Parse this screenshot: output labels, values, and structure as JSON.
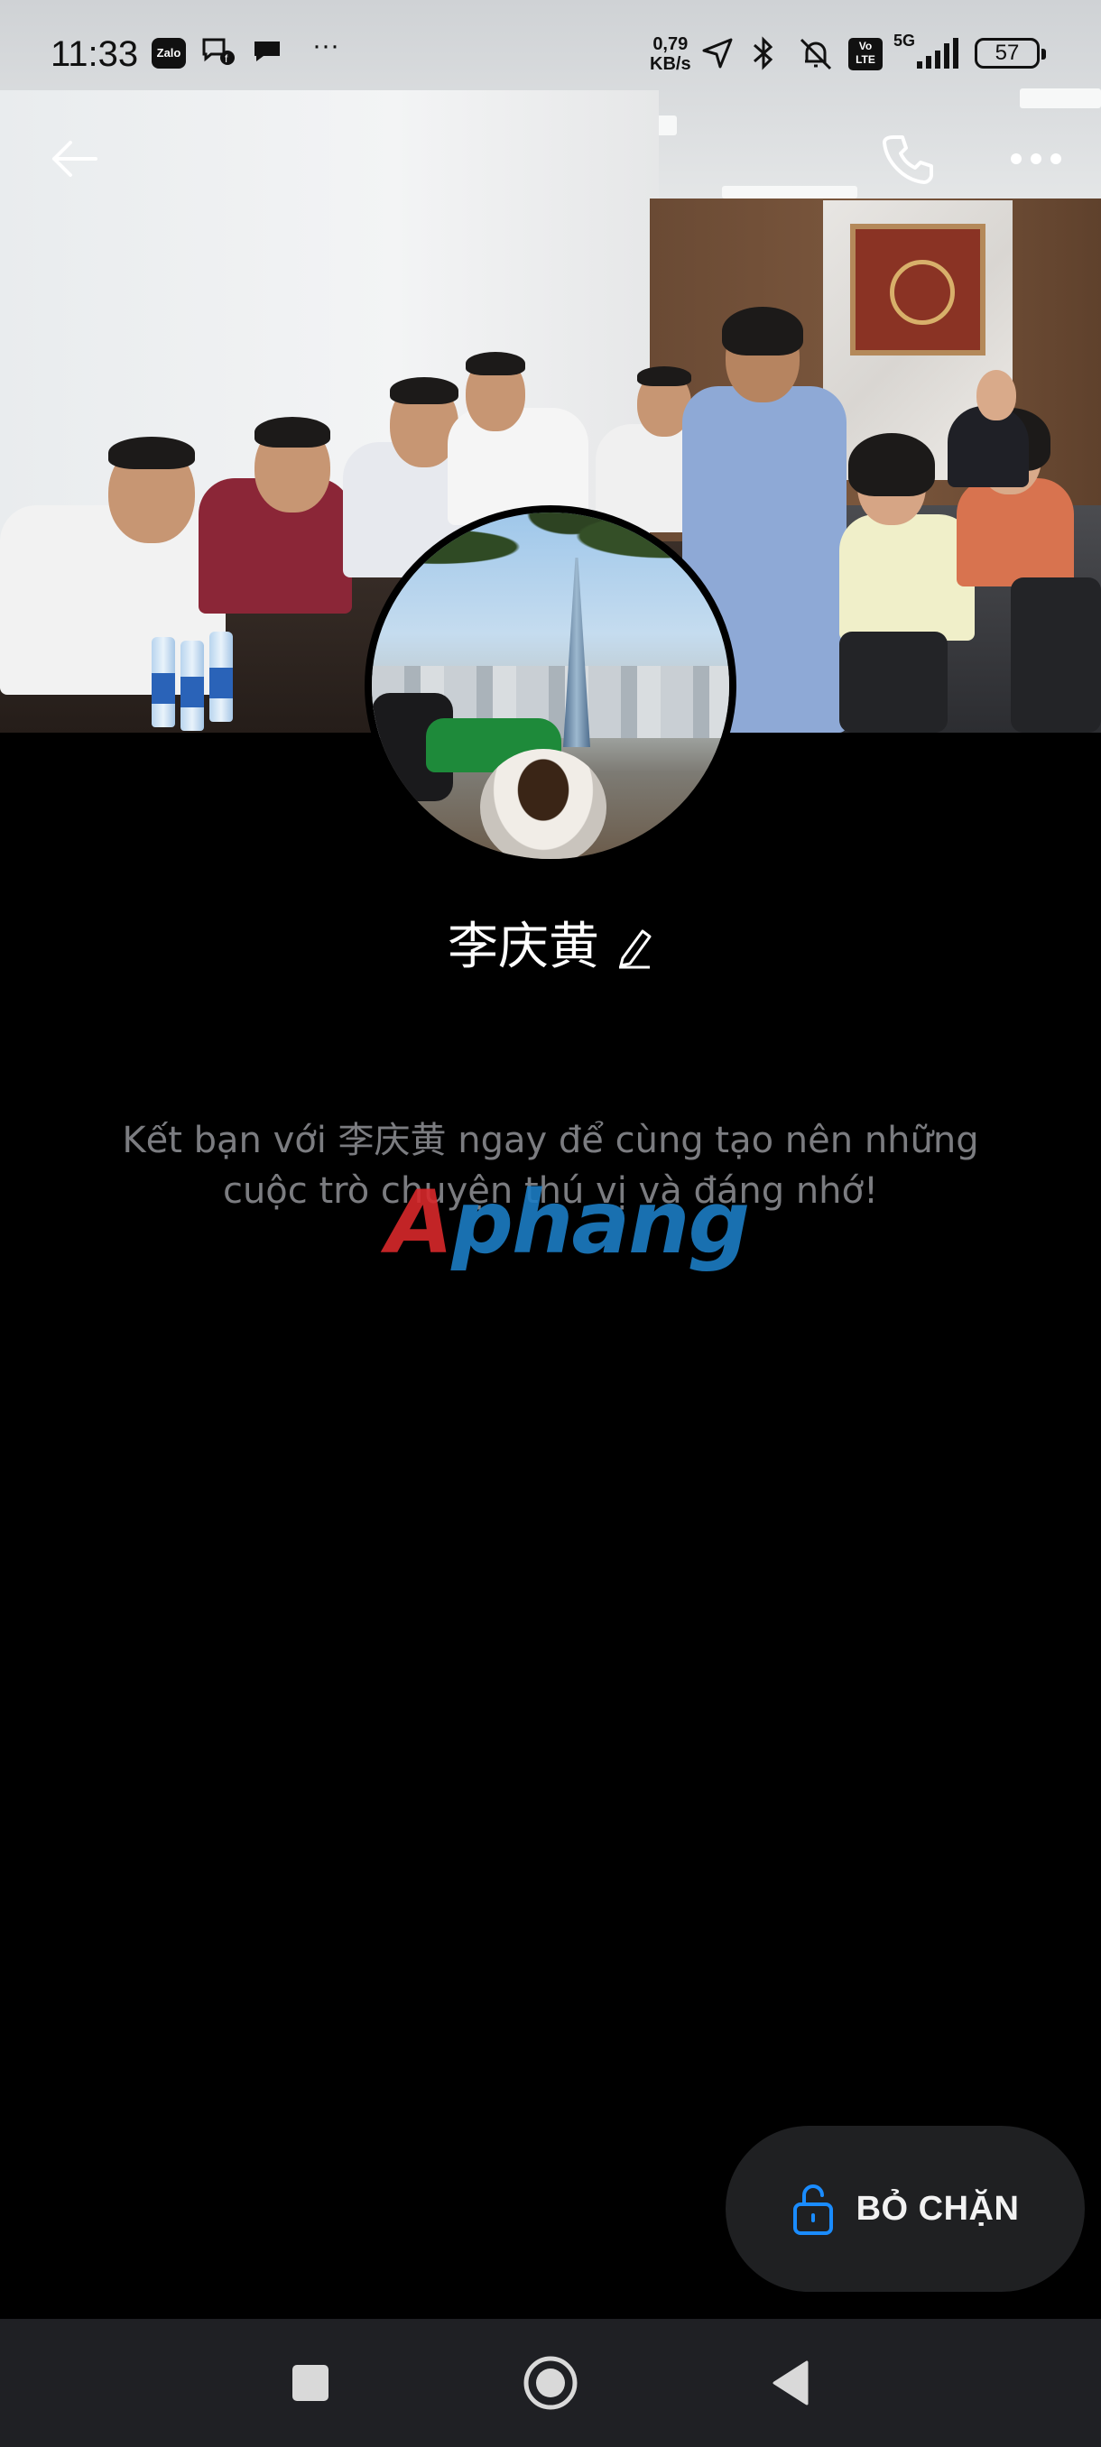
{
  "status_bar": {
    "time": "11:33",
    "zalo_badge": "Zalo",
    "more_notifications": "···",
    "network_speed_value": "0,79",
    "network_speed_unit": "KB/s",
    "volte": "Vo LTE",
    "signal_type": "5G",
    "battery_level": "57"
  },
  "profile": {
    "name": "李庆黄",
    "invite_text": "Kết bạn với 李庆黄 ngay để cùng tạo nên những cuộc trò chuyện thú vị và đáng nhớ!"
  },
  "watermark": {
    "accent_letter": "A",
    "rest": "phang"
  },
  "actions": {
    "unblock_label": "BỎ CHẶN"
  },
  "icons": {
    "back": "back-arrow-icon",
    "call": "phone-icon",
    "more": "more-dots-icon",
    "edit": "pencil-icon",
    "unlock": "unlock-icon",
    "nav_recent": "square-icon",
    "nav_home": "circle-icon",
    "nav_back": "triangle-icon"
  },
  "colors": {
    "background": "#000000",
    "accent": "#1a8cff",
    "button_bg": "#1f2022",
    "muted_text": "#7b7c80",
    "navbar_bg": "#1f2024"
  }
}
